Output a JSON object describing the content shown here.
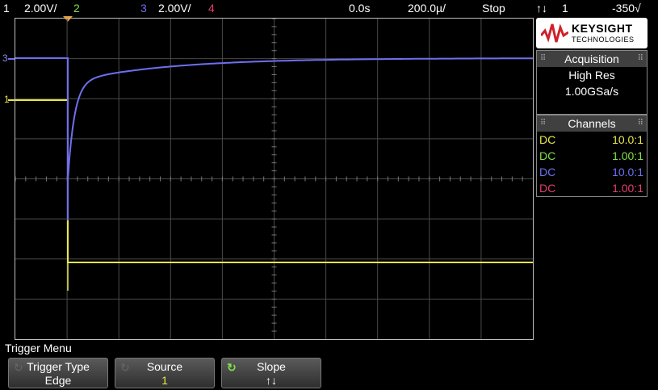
{
  "status_bar": {
    "ch1_num": "1",
    "ch1_scale": "2.00V/",
    "ch2_num": "2",
    "ch3_num": "3",
    "ch3_scale": "2.00V/",
    "ch4_num": "4",
    "time_delay": "0.0s",
    "time_scale": "200.0µ/",
    "run_state": "Stop",
    "trigger_slope_icon": "↑↓",
    "trigger_source": "1",
    "trigger_level": "-350√"
  },
  "colors": {
    "ch1": "#e8e84a",
    "ch2": "#7fe04a",
    "ch3": "#6f6ff0",
    "ch4": "#e0406a",
    "grid": "#4a4a4a"
  },
  "markers": {
    "ch3_label": "3",
    "ch1_label": "1"
  },
  "logo": {
    "brand": "KEYSIGHT",
    "sub": "TECHNOLOGIES"
  },
  "acquisition": {
    "title": "Acquisition",
    "mode": "High Res",
    "rate": "1.00GSa/s"
  },
  "channels": {
    "title": "Channels",
    "rows": [
      {
        "coupling": "DC",
        "probe": "10.0:1",
        "color": "#e8e84a"
      },
      {
        "coupling": "DC",
        "probe": "1.00:1",
        "color": "#7fe04a"
      },
      {
        "coupling": "DC",
        "probe": "10.0:1",
        "color": "#6f6ff0"
      },
      {
        "coupling": "DC",
        "probe": "1.00:1",
        "color": "#e0406a"
      }
    ]
  },
  "menu": {
    "title": "Trigger Menu",
    "softkeys": [
      {
        "label": "Trigger Type",
        "value": "Edge"
      },
      {
        "label": "Source",
        "value": "1"
      },
      {
        "label": "Slope",
        "value": "↑↓"
      }
    ]
  }
}
